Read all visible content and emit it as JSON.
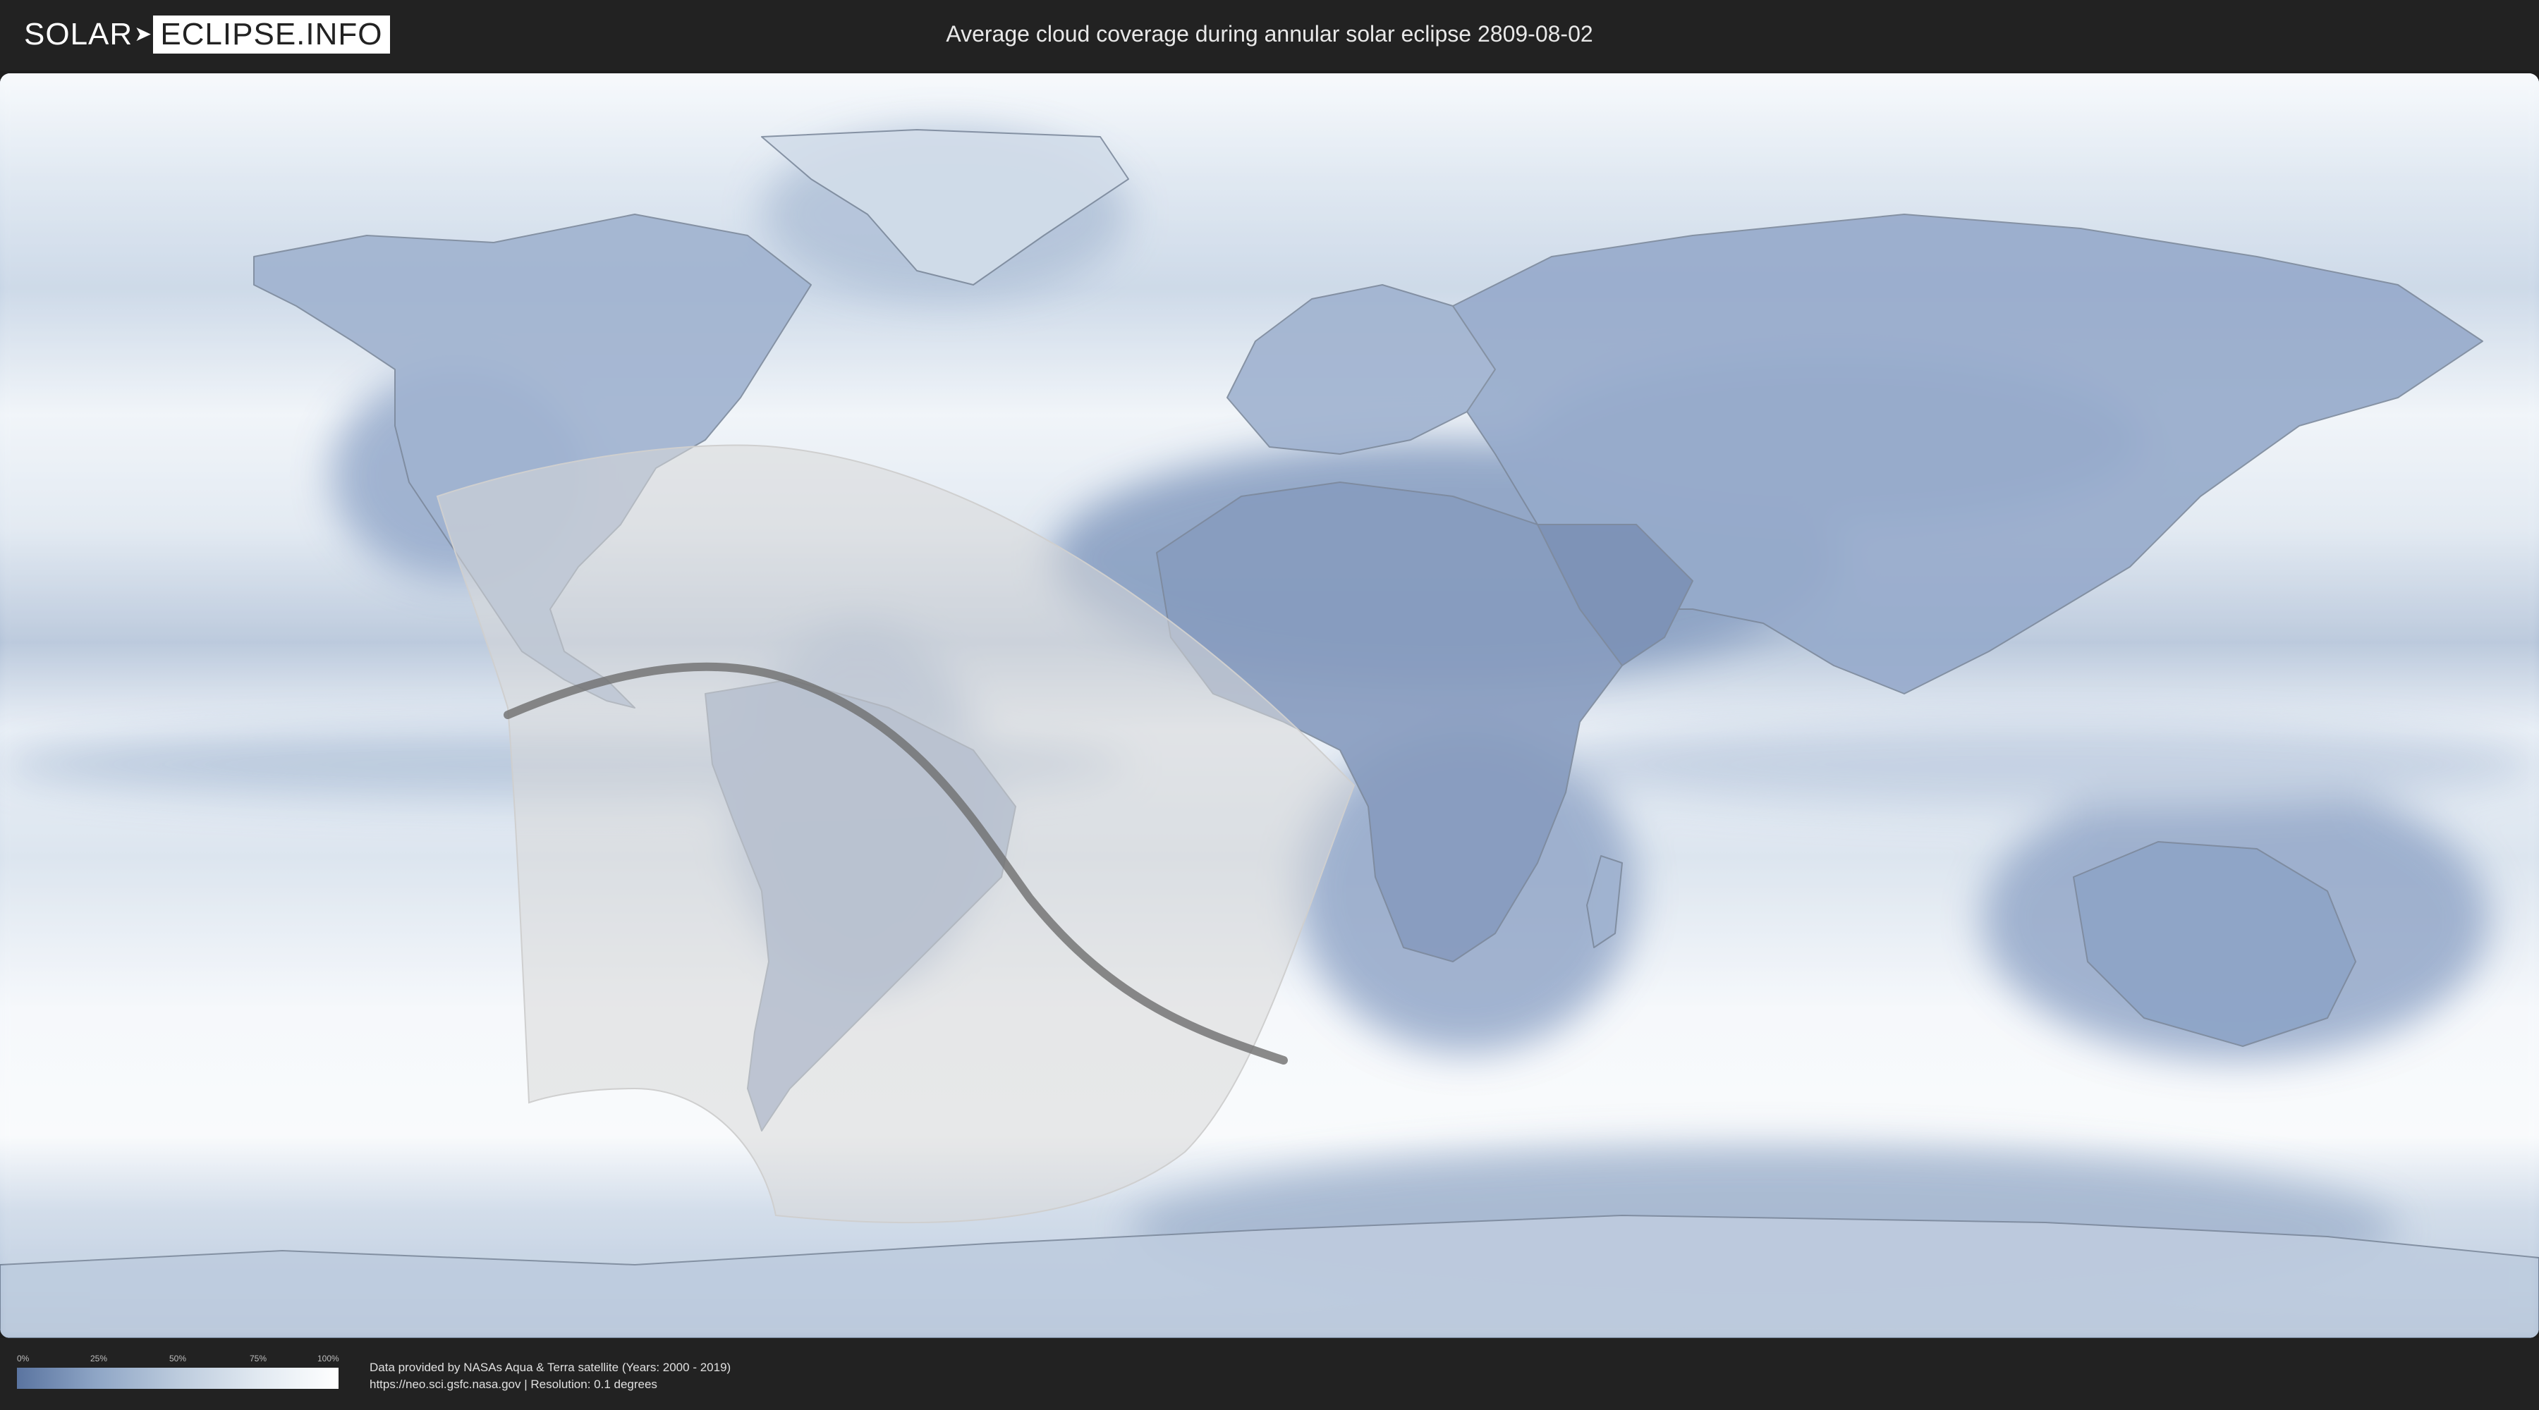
{
  "header": {
    "logo_left": "SOLAR",
    "logo_right": "ECLIPSE.INFO",
    "title": "Average cloud coverage during annular solar eclipse 2809-08-02"
  },
  "legend": {
    "ticks": [
      "0%",
      "25%",
      "50%",
      "75%",
      "100%"
    ],
    "gradient_colors": [
      "#5a74a0",
      "#8fa6c6",
      "#bccbdd",
      "#e1e9f1",
      "#ffffff"
    ]
  },
  "credits": {
    "line1": "Data provided by NASAs Aqua & Terra satellite (Years: 2000 - 2019)",
    "line2": "https://neo.sci.gsfc.nasa.gov | Resolution: 0.1 degrees"
  },
  "colors": {
    "header_bg": "#222222",
    "cloud_clear": "#5a74a0",
    "cloud_full": "#ffffff",
    "eclipse_zone": "#d8d8d8",
    "central_line": "#6e6e6e"
  },
  "map": {
    "projection": "equirectangular world map",
    "features": [
      "continents",
      "country borders",
      "cloud coverage shading",
      "eclipse visibility zone",
      "central path of annularity"
    ]
  }
}
